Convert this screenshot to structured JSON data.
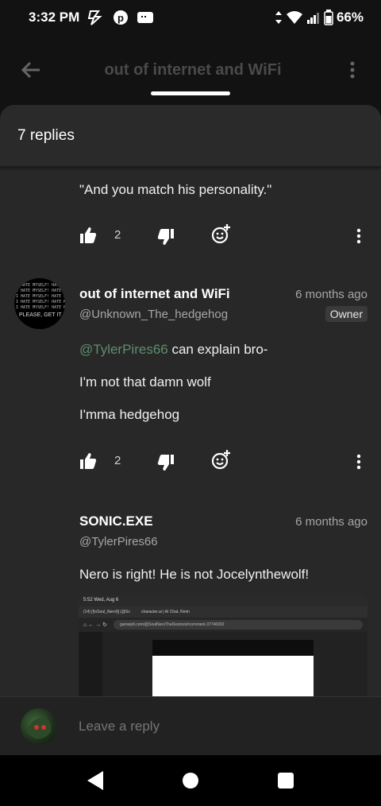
{
  "status_bar": {
    "time": "3:32 PM",
    "icons_left": [
      "lightning-icon",
      "pinterest-icon",
      "chat-icon"
    ],
    "battery": "66%"
  },
  "app_header": {
    "title": "out of internet and WiFi"
  },
  "sheet": {
    "title": "7 replies"
  },
  "top_comment": {
    "text": "\"And you match his personality.\"",
    "likes": "2"
  },
  "reply1": {
    "author": "out of internet and WiFi",
    "handle": "@Unknown_The_hedgehog",
    "time": "6 months ago",
    "badge": "Owner",
    "mention": "@TylerPires66",
    "line1_rest": " can explain bro-",
    "line2": "I'm not that damn wolf",
    "line3": "I'mma hedgehog",
    "likes": "2",
    "avatar_text": "PLEASE, GET IT"
  },
  "reply2": {
    "author": "SONIC.EXE",
    "handle": "@TylerPires66",
    "time": "6 months ago",
    "text": "Nero is right! He is not Jocelynthewolf!"
  },
  "embedded_screenshot": {
    "status": "5:52  Wed, Aug 6",
    "tab1": "(14) [§oSoul_Nero§] (@Sc",
    "tab2": "character.ai | AI Chat, Reim",
    "url": "gamejolt.com/@SoulNeroTheDestroni#comment-37740092"
  },
  "reply_bar": {
    "placeholder": "Leave a reply"
  }
}
